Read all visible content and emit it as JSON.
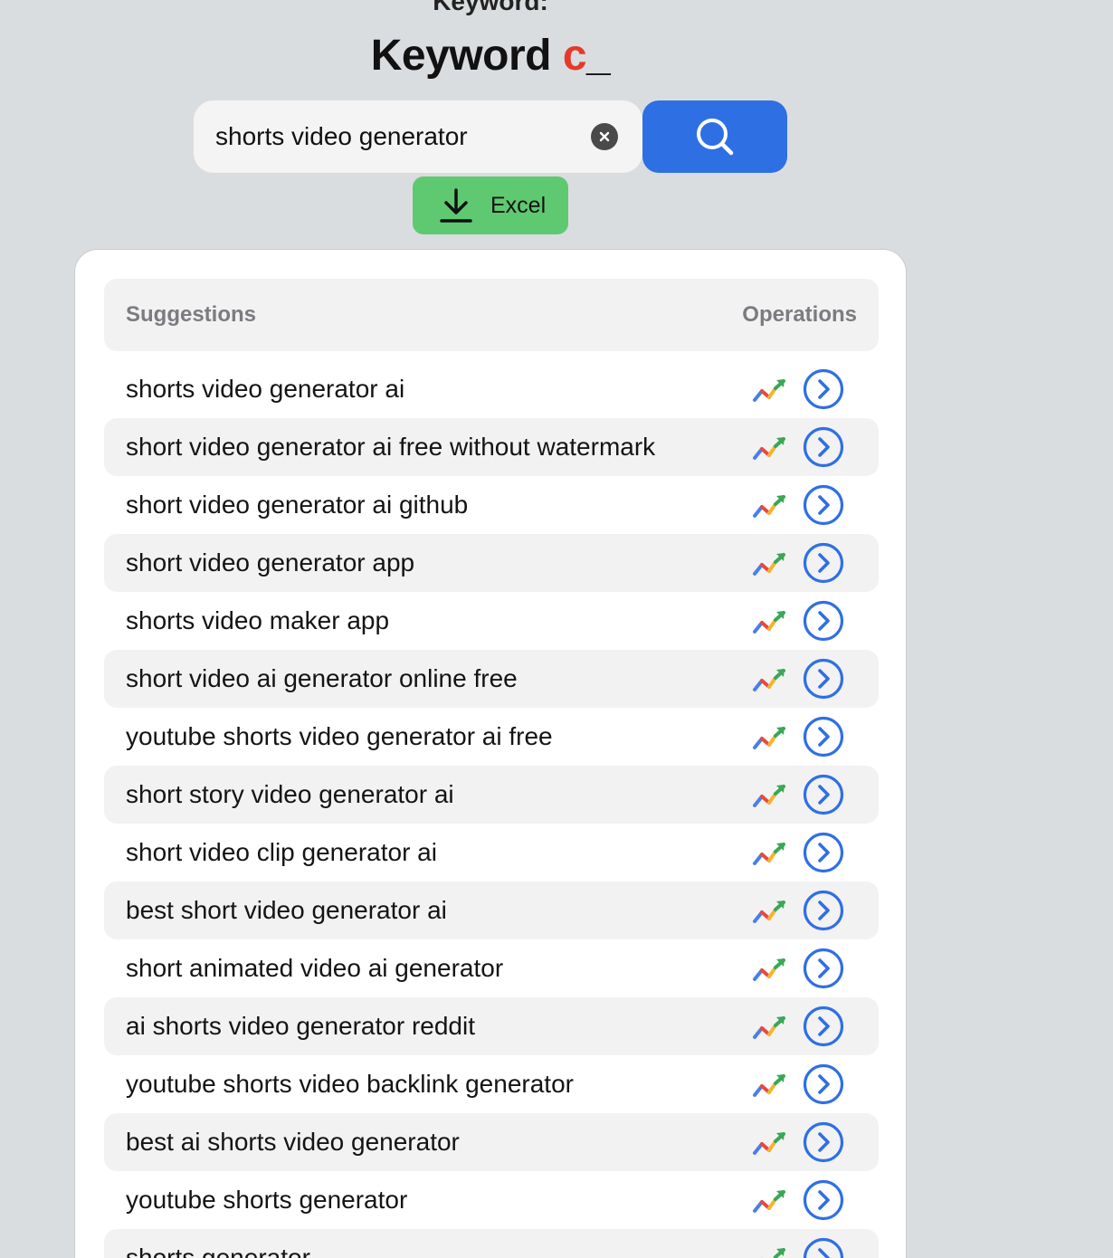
{
  "header": {
    "top_cut_text": "Keyword:",
    "title_main": "Keyword",
    "title_accent": "c",
    "title_cursor": "_",
    "accent_color": "#e53a2a"
  },
  "search": {
    "value": "shorts video generator",
    "button_color": "#2f6fe4",
    "icon": "search-icon",
    "clear_icon": "close-icon"
  },
  "export": {
    "label": "Excel",
    "icon": "download-icon",
    "color": "#5fc971"
  },
  "table": {
    "col_suggestions": "Suggestions",
    "col_operations": "Operations",
    "row_icons": [
      "trend-chart-icon",
      "chevron-right-circle-icon"
    ],
    "rows": [
      "shorts video generator ai",
      "short video generator ai free without watermark",
      "short video generator ai github",
      "short video generator app",
      "shorts video maker app",
      "short video ai generator online free",
      "youtube shorts video generator ai free",
      "short story video generator ai",
      "short video clip generator ai",
      "best short video generator ai",
      "short animated video ai generator",
      "ai shorts video generator reddit",
      "youtube shorts video backlink generator",
      "best ai shorts video generator",
      "youtube shorts generator",
      "shorts generator"
    ]
  }
}
